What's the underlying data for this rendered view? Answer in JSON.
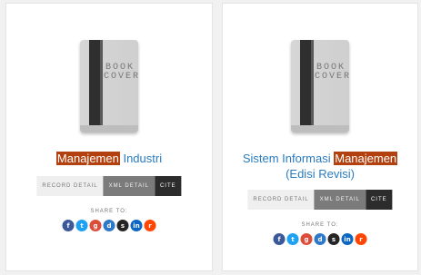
{
  "cover_text": [
    "BOOK",
    "COVER"
  ],
  "buttons": {
    "record": "RECORD DETAIL",
    "xml": "XML DETAIL",
    "cite": "CITE"
  },
  "share_label": "SHARE TO:",
  "share_icons": [
    {
      "name": "facebook-icon",
      "glyph": "f",
      "color": "#3b5998"
    },
    {
      "name": "twitter-icon",
      "glyph": "t",
      "color": "#1da1f2"
    },
    {
      "name": "google-plus-icon",
      "glyph": "g",
      "color": "#dd4b39"
    },
    {
      "name": "digg-icon",
      "glyph": "d",
      "color": "#2e78c8"
    },
    {
      "name": "stumbleupon-icon",
      "glyph": "s",
      "color": "#252525"
    },
    {
      "name": "linkedin-icon",
      "glyph": "in",
      "color": "#0a66c2"
    },
    {
      "name": "reddit-icon",
      "glyph": "r",
      "color": "#ff4500"
    }
  ],
  "cards": [
    {
      "title_parts": [
        "Manajemen",
        " Industri"
      ],
      "highlight": "Manajemen"
    },
    {
      "title_parts": [
        "Sistem Informasi ",
        "Manajemen",
        " (Edisi Revisi)"
      ],
      "highlight": "Manajemen"
    }
  ]
}
